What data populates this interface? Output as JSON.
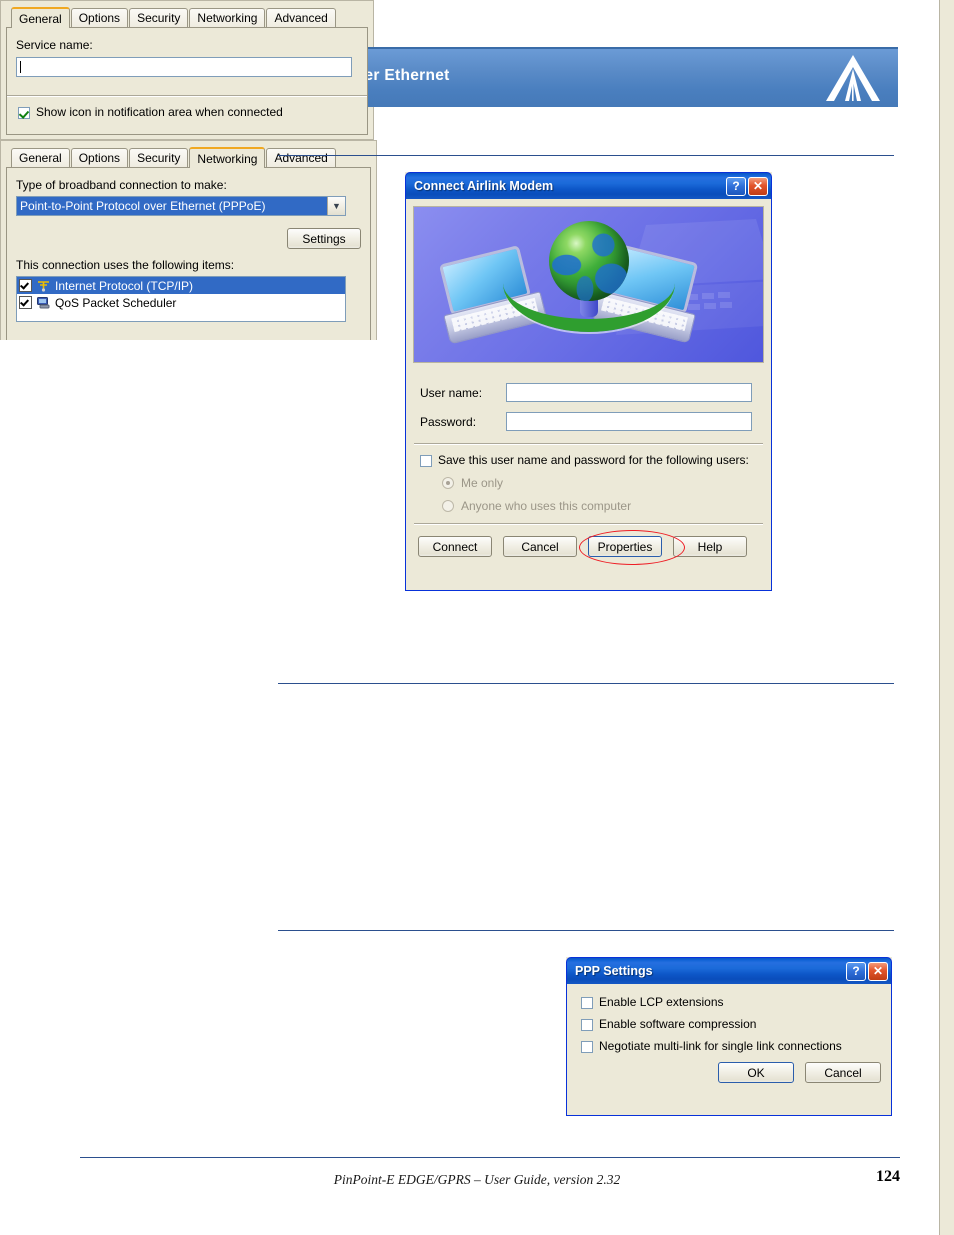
{
  "page": {
    "header_title": "PPPoE: Point to Point Protocol over Ethernet",
    "logo_name": "airlink-triangle-logo",
    "accent_blue": "#4a7fbf",
    "rule_color": "#2b4f8e",
    "footer_text": "PinPoint-E EDGE/GPRS – User Guide, version 2.32",
    "page_number": "124"
  },
  "connect_dialog": {
    "title": "Connect Airlink Modem",
    "help_button": "?",
    "close_button": "✕",
    "banner_art": "globe-with-two-laptops-illustration",
    "username_label": "User name:",
    "username_value": "",
    "password_label": "Password:",
    "password_value": "",
    "save_checkbox_label": "Save this user name and password for the following users:",
    "save_checkbox_checked": false,
    "radio_me_only": "Me only",
    "radio_me_only_selected": true,
    "radio_anyone": "Anyone who uses this computer",
    "radio_anyone_selected": false,
    "buttons": {
      "connect": "Connect",
      "cancel": "Cancel",
      "properties": "Properties",
      "help": "Help"
    },
    "highlight_target": "Properties",
    "highlight_color": "#ee1c24"
  },
  "general_dialog": {
    "tabs": [
      {
        "label": "General",
        "active": true
      },
      {
        "label": "Options",
        "active": false
      },
      {
        "label": "Security",
        "active": false
      },
      {
        "label": "Networking",
        "active": false
      },
      {
        "label": "Advanced",
        "active": false
      }
    ],
    "service_name_label": "Service name:",
    "service_name_value": "",
    "show_icon_checkbox_label": "Show icon in notification area when connected",
    "show_icon_checked": true
  },
  "networking_dialog": {
    "tabs": [
      {
        "label": "General",
        "active": false
      },
      {
        "label": "Options",
        "active": false
      },
      {
        "label": "Security",
        "active": false
      },
      {
        "label": "Networking",
        "active": true
      },
      {
        "label": "Advanced",
        "active": false
      }
    ],
    "connection_type_label": "Type of broadband connection to make:",
    "connection_type_value": "Point-to-Point Protocol over Ethernet (PPPoE)",
    "settings_button": "Settings",
    "items_label": "This connection uses the following items:",
    "items": [
      {
        "label": "Internet Protocol (TCP/IP)",
        "checked": true,
        "selected": true,
        "icon": "network-protocol-icon"
      },
      {
        "label": "QoS Packet Scheduler",
        "checked": true,
        "selected": false,
        "icon": "computer-icon"
      }
    ]
  },
  "ppp_settings_dialog": {
    "title": "PPP Settings",
    "help_button": "?",
    "close_button": "✕",
    "options": [
      {
        "label": "Enable LCP extensions",
        "checked": false
      },
      {
        "label": "Enable software compression",
        "checked": false
      },
      {
        "label": "Negotiate multi-link for single link connections",
        "checked": false
      }
    ],
    "ok_button": "OK",
    "cancel_button": "Cancel"
  }
}
